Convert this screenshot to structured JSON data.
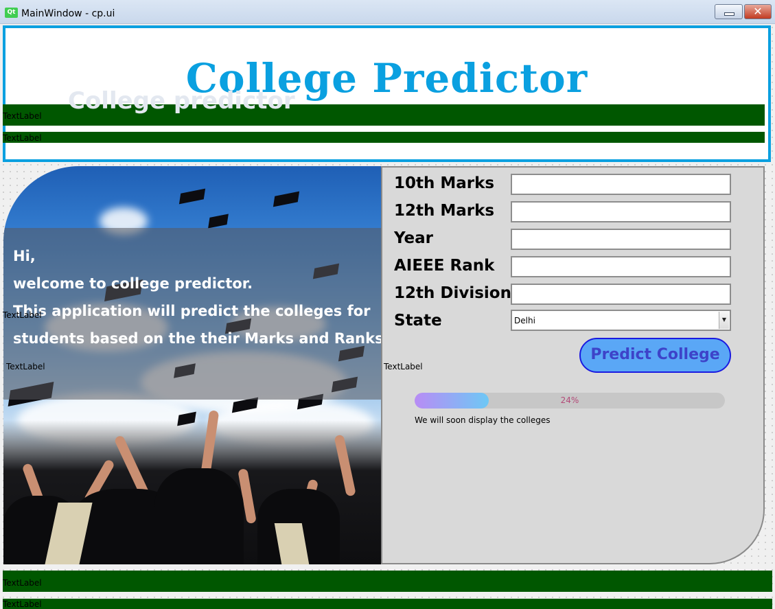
{
  "window": {
    "app_icon": "Qt",
    "title": "MainWindow - cp.ui",
    "close_glyph": "✕"
  },
  "header": {
    "title": "College Predictor",
    "label_1": "TextLabel",
    "label_2": "TextLabel"
  },
  "hero": {
    "overlay_title": "College predictor",
    "lines": [
      "Hi,",
      "welcome to college predictor.",
      "This application will predict the colleges for",
      "students based on the their Marks and Ranks"
    ],
    "side_label": "TextLabel",
    "bottom_label": "TextLabel"
  },
  "form": {
    "fields": [
      {
        "label": "10th Marks",
        "value": ""
      },
      {
        "label": "12th Marks",
        "value": ""
      },
      {
        "label": "Year",
        "value": ""
      },
      {
        "label": "AIEEE Rank",
        "value": ""
      },
      {
        "label": "12th Division",
        "value": ""
      }
    ],
    "state_label": "State",
    "state_value": "Delhi",
    "predict_button": "Predict College",
    "side_label": "TextLabel",
    "progress": {
      "percent": 24,
      "text": "24%",
      "message": "We will soon display the colleges"
    }
  },
  "footer": {
    "label_1": "TextLabel",
    "label_2": "TextLabel"
  },
  "colors": {
    "accent": "#0aa0e0",
    "green_bar": "#005700",
    "button_bg": "#5aa7f6",
    "panel_bg": "#d9d9d9"
  }
}
